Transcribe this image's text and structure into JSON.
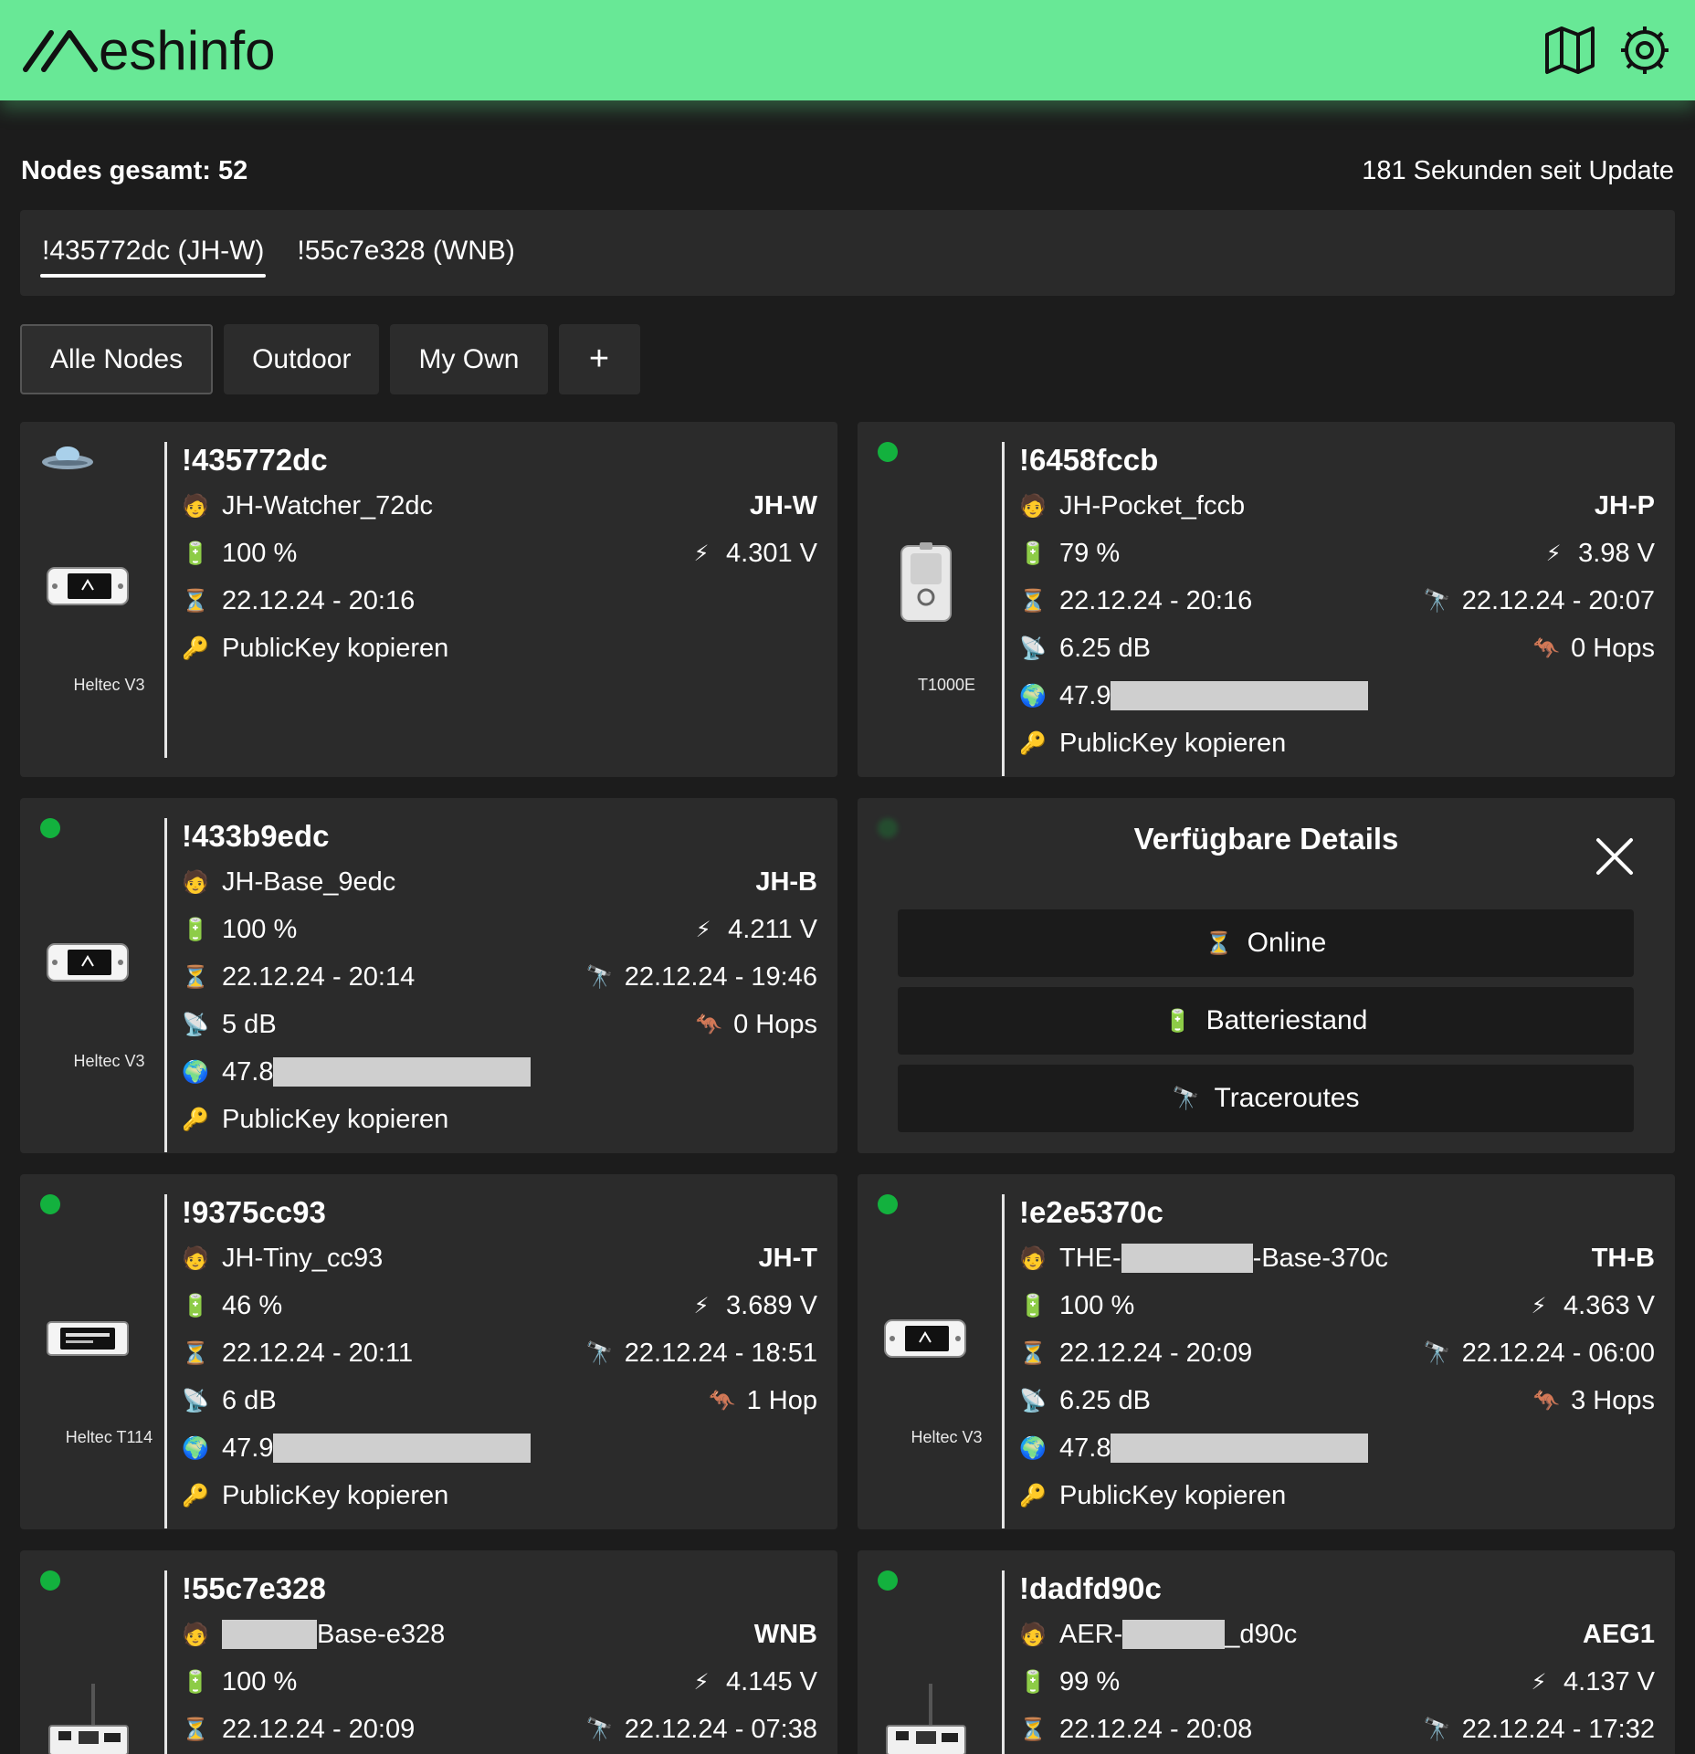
{
  "app": {
    "title": "Meshinfo",
    "logo_text": "eshinfo",
    "colors": {
      "header": "#68e896",
      "online": "#13b13e"
    }
  },
  "header": {
    "icons": [
      "map-icon",
      "settings-icon"
    ]
  },
  "status": {
    "total": "Nodes gesamt: 52",
    "update": "181 Sekunden seit Update"
  },
  "gateways": [
    {
      "label": "!435772dc (JH-W)",
      "active": true
    },
    {
      "label": "!55c7e328 (WNB)",
      "active": false
    }
  ],
  "filters": {
    "all": "Alle Nodes",
    "outdoor": "Outdoor",
    "myown": "My Own",
    "add": "+"
  },
  "nodes": [
    {
      "id": "!435772dc",
      "long": "JH-Watcher_72dc",
      "short": "JH-W",
      "battery": "100 %",
      "voltage": "4.301 V",
      "lastseen": "22.12.24 - 20:16",
      "publickey": "PublicKey kopieren",
      "model": "Heltec V3"
    },
    {
      "id": "!6458fccb",
      "long": "JH-Pocket_fccb",
      "short": "JH-P",
      "battery": "79 %",
      "voltage": "3.98 V",
      "lastseen": "22.12.24 - 20:16",
      "traceroute": "22.12.24 - 20:07",
      "snr": "6.25 dB",
      "hops": "0 Hops",
      "position": "47.9",
      "publickey": "PublicKey kopieren",
      "model": "T1000E"
    },
    {
      "id": "!433b9edc",
      "long": "JH-Base_9edc",
      "short": "JH-B",
      "battery": "100 %",
      "voltage": "4.211 V",
      "lastseen": "22.12.24 - 20:14",
      "traceroute": "22.12.24 - 19:46",
      "snr": "5 dB",
      "hops": "0 Hops",
      "position": "47.8",
      "publickey": "PublicKey kopieren",
      "model": "Heltec V3"
    },
    {
      "id": "!9375cc93",
      "long": "JH-Tiny_cc93",
      "short": "JH-T",
      "battery": "46 %",
      "voltage": "3.689 V",
      "lastseen": "22.12.24 - 20:11",
      "traceroute": "22.12.24 - 18:51",
      "snr": "6 dB",
      "hops": "1 Hop",
      "position": "47.9",
      "publickey": "PublicKey kopieren",
      "model": "Heltec T114"
    },
    {
      "id": "!e2e5370c",
      "long_prefix": "THE-",
      "long_suffix": "-Base-370c",
      "short": "TH-B",
      "battery": "100 %",
      "voltage": "4.363 V",
      "lastseen": "22.12.24 - 20:09",
      "traceroute": "22.12.24 - 06:00",
      "snr": "6.25 dB",
      "hops": "3 Hops",
      "position": "47.8",
      "publickey": "PublicKey kopieren",
      "model": "Heltec V3"
    },
    {
      "id": "!55c7e328",
      "long_suffix": "Base-e328",
      "short": "WNB",
      "battery": "100 %",
      "voltage": "4.145 V",
      "lastseen": "22.12.24 - 20:09",
      "traceroute": "22.12.24 - 07:38"
    },
    {
      "id": "!dadfd90c",
      "long_prefix": "AER-",
      "long_suffix": "_d90c",
      "short": "AEG1",
      "battery": "99 %",
      "voltage": "4.137 V",
      "lastseen": "22.12.24 - 20:08",
      "traceroute": "22.12.24 - 17:32"
    }
  ],
  "overlay": {
    "title": "Verfügbare Details",
    "buttons": {
      "online": "Online",
      "battery": "Batteriestand",
      "traceroutes": "Traceroutes"
    }
  }
}
